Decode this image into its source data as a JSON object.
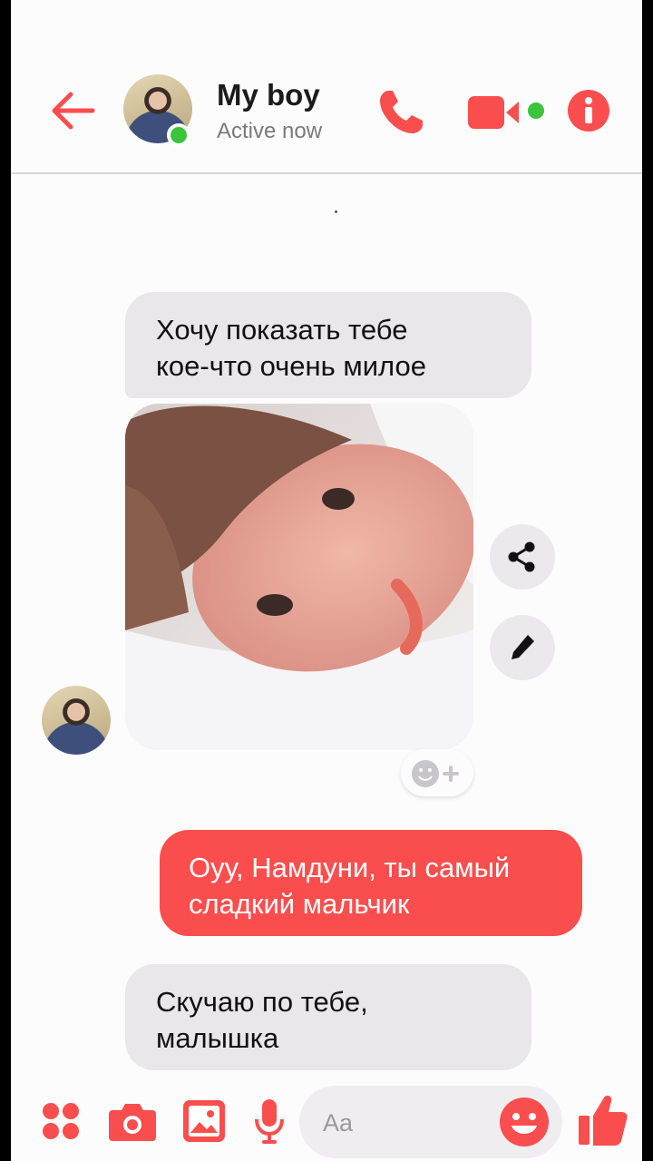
{
  "header": {
    "contact_name": "My boy",
    "status": "Active now"
  },
  "messages": [
    {
      "from": "contact",
      "lines": [
        "Хочу показать тебе",
        "кое-что очень милое"
      ]
    },
    {
      "from": "contact",
      "type": "photo"
    },
    {
      "from": "me",
      "lines": [
        "Оуу, Намдуни, ты самый",
        "сладкий мальчик"
      ]
    },
    {
      "from": "contact",
      "lines": [
        "Скучаю по тебе,",
        "малышка"
      ]
    }
  ],
  "composer": {
    "placeholder": "Aa"
  },
  "colors": {
    "accent": "#fa4e4e",
    "online": "#3cc43c",
    "incoming_bubble": "#e9e7ea"
  },
  "icons": [
    "back-arrow-icon",
    "phone-icon",
    "video-camera-icon",
    "info-icon",
    "share-icon",
    "pencil-icon",
    "add-reaction-icon",
    "more-apps-icon",
    "camera-icon",
    "gallery-icon",
    "microphone-icon",
    "emoji-icon",
    "thumbs-up-icon"
  ]
}
